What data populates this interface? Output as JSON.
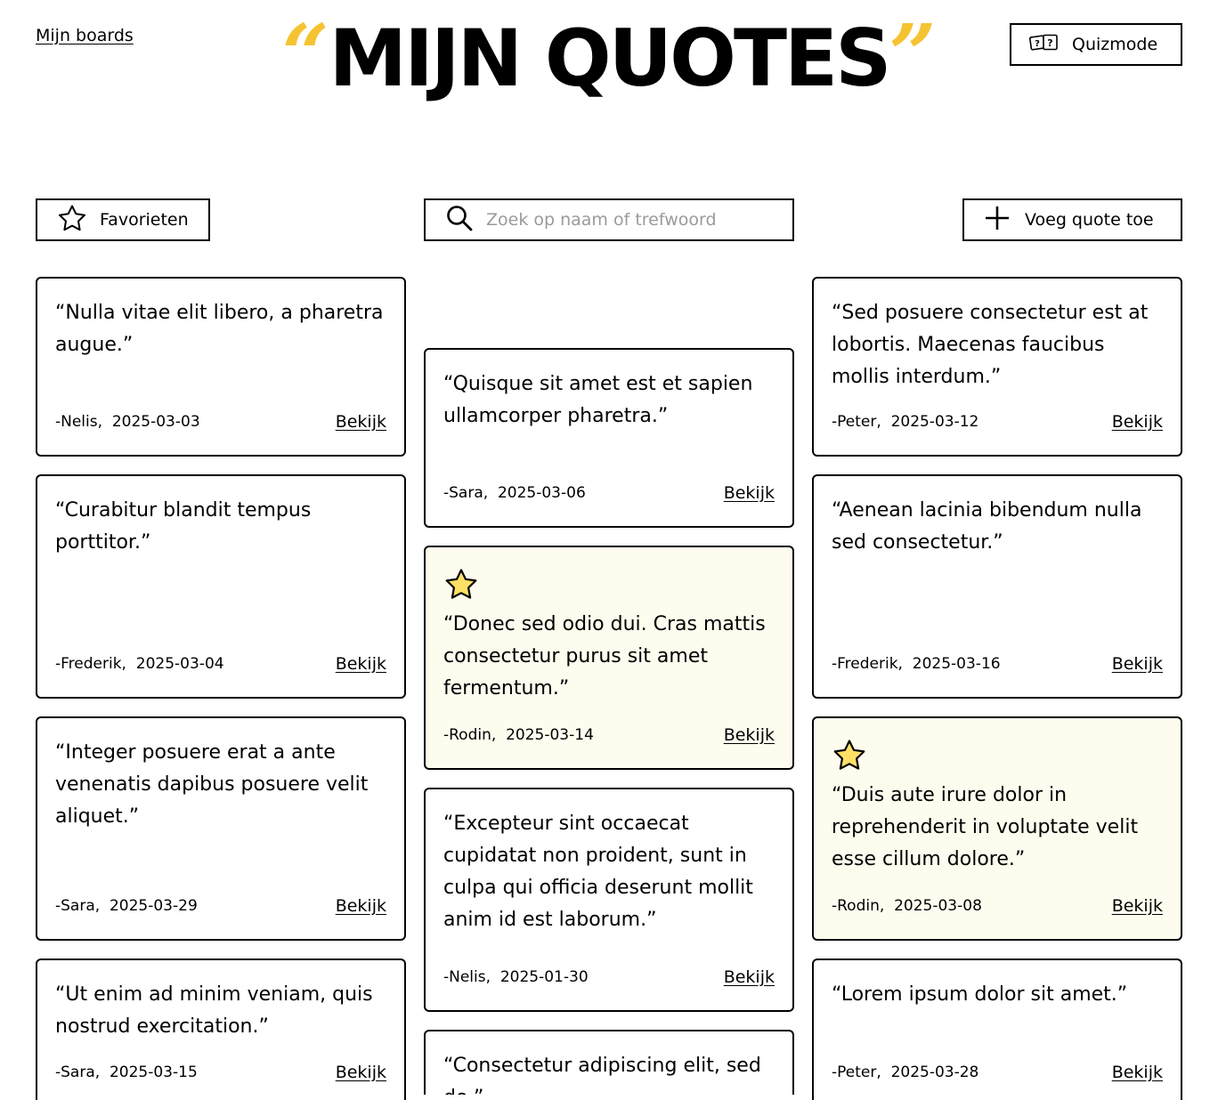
{
  "header": {
    "back_link": "Mijn boards",
    "title": "MIJN QUOTES",
    "open_quote": "“",
    "close_quote": "”",
    "quiz_label": "Quizmode"
  },
  "toolbar": {
    "favorites_label": "Favorieten",
    "search_placeholder": "Zoek op naam of trefwoord",
    "search_value": "",
    "add_label": "Voeg quote toe"
  },
  "colors": {
    "accent": "#f5c332",
    "favorite_bg": "#fefcee",
    "star_fill": "#ffe066"
  },
  "columns": [
    {
      "cards": [
        {
          "quote": "“Nulla vitae elit libero, a pharetra augue.”",
          "author": "-Nelis,",
          "date": "2025-03-03",
          "action": "Bekijk",
          "favorite": false
        },
        {
          "quote": "“Curabitur blandit tempus porttitor.”",
          "author": "-Frederik,",
          "date": "2025-03-04",
          "action": "Bekijk",
          "favorite": false
        },
        {
          "quote": "“Integer posuere erat a ante venenatis dapibus posuere velit aliquet.”",
          "author": "-Sara,",
          "date": "2025-03-29",
          "action": "Bekijk",
          "favorite": false
        },
        {
          "quote": "“Ut enim ad minim veniam, quis nostrud exercitation.”",
          "author": "-Sara,",
          "date": "2025-03-15",
          "action": "Bekijk",
          "favorite": false
        }
      ]
    },
    {
      "cards": [
        {
          "quote": "“Quisque sit amet est et sapien ullamcorper pharetra.”",
          "author": "-Sara,",
          "date": "2025-03-06",
          "action": "Bekijk",
          "favorite": false
        },
        {
          "quote": "“Donec sed odio dui. Cras mattis consectetur purus sit amet fermentum.”",
          "author": "-Rodin,",
          "date": "2025-03-14",
          "action": "Bekijk",
          "favorite": true
        },
        {
          "quote": "“Excepteur sint occaecat cupidatat non proident, sunt in culpa qui officia deserunt mollit anim id est laborum.”",
          "author": "-Nelis,",
          "date": "2025-01-30",
          "action": "Bekijk",
          "favorite": false
        },
        {
          "quote": "“Consectetur adipiscing elit, sed do.”",
          "author": "",
          "date": "",
          "action": "",
          "favorite": false
        }
      ]
    },
    {
      "cards": [
        {
          "quote": "“Sed posuere consectetur est at lobortis. Maecenas faucibus mollis interdum.”",
          "author": "-Peter,",
          "date": "2025-03-12",
          "action": "Bekijk",
          "favorite": false
        },
        {
          "quote": "“Aenean lacinia bibendum nulla sed consectetur.”",
          "author": "-Frederik,",
          "date": "2025-03-16",
          "action": "Bekijk",
          "favorite": false
        },
        {
          "quote": "“Duis aute irure dolor in reprehenderit in voluptate velit esse cillum dolore.”",
          "author": "-Rodin,",
          "date": "2025-03-08",
          "action": "Bekijk",
          "favorite": true
        },
        {
          "quote": "“Lorem ipsum dolor sit amet.”",
          "author": "-Peter,",
          "date": "2025-03-28",
          "action": "Bekijk",
          "favorite": false
        }
      ]
    }
  ]
}
